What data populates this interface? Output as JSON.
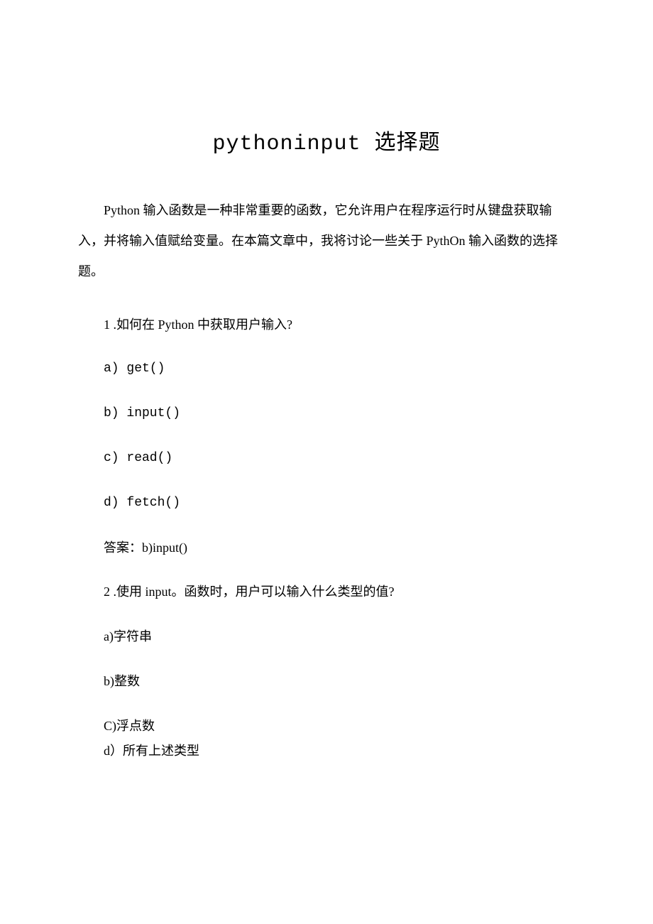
{
  "title": "pythoninput 选择题",
  "intro": "Python 输入函数是一种非常重要的函数，它允许用户在程序运行时从键盘获取输入，并将输入值赋给变量。在本篇文章中，我将讨论一些关于 PythOn 输入函数的选择题。",
  "q1": {
    "prompt": "1 .如何在 Python 中获取用户输入?",
    "a": "a)  get()",
    "b": "b)  input()",
    "c": "c)  read()",
    "d": "d)  fetch()",
    "answer": "答案：b)input()"
  },
  "q2": {
    "prompt": "2 .使用 input。函数时，用户可以输入什么类型的值?",
    "a": "a)字符串",
    "b": "b)整数",
    "c": "C)浮点数",
    "d": "d）所有上述类型"
  }
}
